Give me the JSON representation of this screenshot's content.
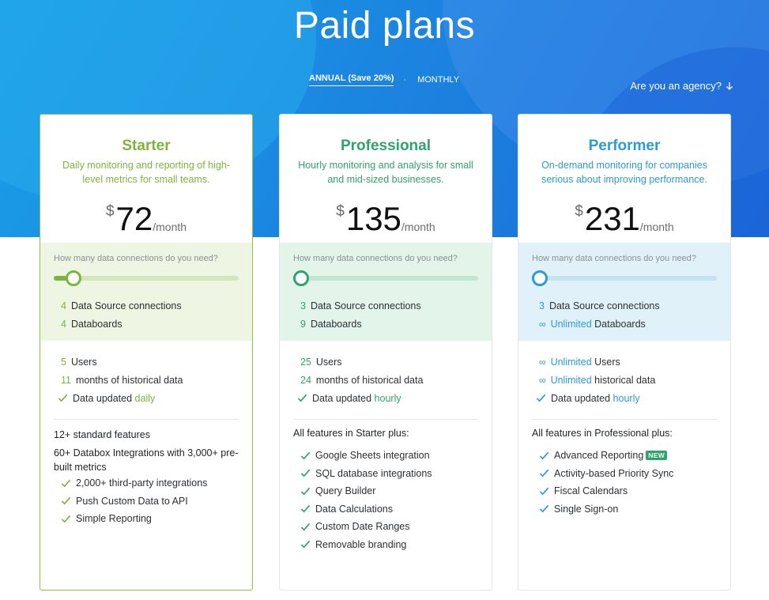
{
  "header": {
    "title": "Paid plans",
    "billing": {
      "annual_label": "ANNUAL",
      "annual_save": "(Save 20%)",
      "separator": "·",
      "monthly_label": "MONTHLY",
      "selected": "annual"
    },
    "agency_link": "Are you an agency?"
  },
  "colors": {
    "starter": "#7cb53b",
    "professional": "#2ea36b",
    "performer": "#2b9bd0",
    "hero": "#1b86e0"
  },
  "plans": [
    {
      "name": "Starter",
      "description": "Daily monitoring and reporting of high-level metrics for small teams.",
      "currency": "$",
      "price": "72",
      "period": "/month",
      "connections_question": "How many data connections do you need?",
      "slider_value": 0.07,
      "data_sources_count": "4",
      "data_sources_label": "Data Source connections",
      "databoards_count": "4",
      "databoards_label": "Databoards",
      "users_count": "5",
      "users_label": "Users",
      "history_count": "11",
      "history_label": "months of historical data",
      "updated_prefix": "Data updated",
      "updated_value": "daily",
      "feature_head_1": "12+ standard features",
      "feature_head_2": "60+ Databox Integrations with 3,000+ pre-built metrics",
      "features": [
        "2,000+ third-party integrations",
        "Push Custom Data to API",
        "Simple Reporting"
      ]
    },
    {
      "name": "Professional",
      "description": "Hourly monitoring and analysis for small and mid-sized businesses.",
      "currency": "$",
      "price": "135",
      "period": "/month",
      "connections_question": "How many data connections do you need?",
      "slider_value": 0.0,
      "data_sources_count": "3",
      "data_sources_label": "Data Source connections",
      "databoards_count": "9",
      "databoards_label": "Databoards",
      "users_count": "25",
      "users_label": "Users",
      "history_count": "24",
      "history_label": "months of historical data",
      "updated_prefix": "Data updated",
      "updated_value": "hourly",
      "feature_head": "All features in Starter plus:",
      "features": [
        "Google Sheets integration",
        "SQL database integrations",
        "Query Builder",
        "Data Calculations",
        "Custom Date Ranges",
        "Removable branding"
      ]
    },
    {
      "name": "Performer",
      "description": "On-demand monitoring for companies serious about improving performance.",
      "currency": "$",
      "price": "231",
      "period": "/month",
      "connections_question": "How many data connections do you need?",
      "slider_value": 0.0,
      "data_sources_count": "3",
      "data_sources_label": "Data Source connections",
      "databoards_count": "∞",
      "databoards_unlimited": "Unlimited",
      "databoards_label": "Databoards",
      "users_count": "∞",
      "users_unlimited": "Unlimited",
      "users_label": "Users",
      "history_count": "∞",
      "history_unlimited": "Unlimited",
      "history_label": "historical data",
      "updated_prefix": "Data updated",
      "updated_value": "hourly",
      "feature_head": "All features in Professional plus:",
      "features": [
        "Advanced Reporting",
        "Activity-based Priority Sync",
        "Fiscal Calendars",
        "Single Sign-on"
      ],
      "new_badge": "NEW"
    }
  ]
}
